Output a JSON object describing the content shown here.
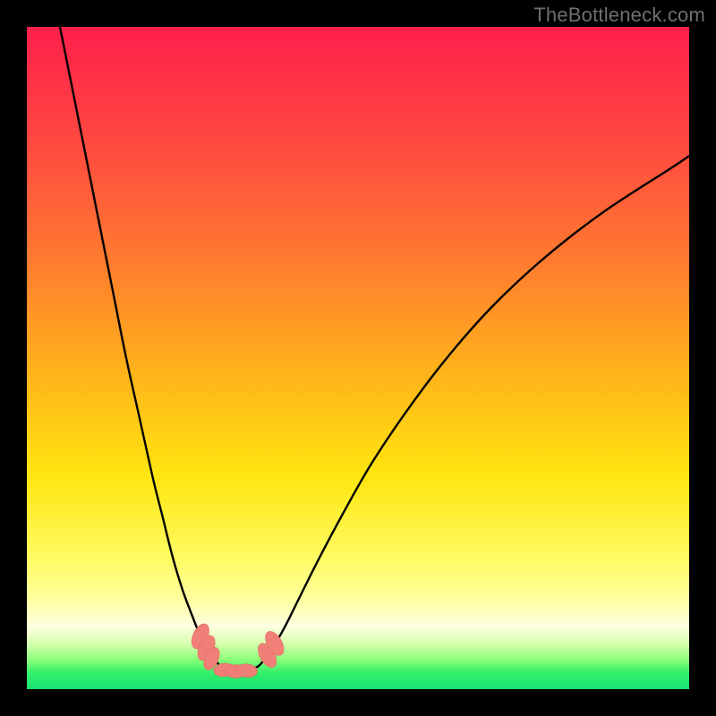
{
  "watermark": "TheBottleneck.com",
  "chart_data": {
    "type": "line",
    "title": "",
    "xlabel": "",
    "ylabel": "",
    "xlim": [
      0,
      100
    ],
    "ylim": [
      0,
      100
    ],
    "grid": false,
    "legend": false,
    "background_gradient_stops": [
      {
        "offset": 0.0,
        "color": "#ff1f4b"
      },
      {
        "offset": 0.18,
        "color": "#ff4a40"
      },
      {
        "offset": 0.35,
        "color": "#ff7a30"
      },
      {
        "offset": 0.52,
        "color": "#ffb21a"
      },
      {
        "offset": 0.68,
        "color": "#ffe610"
      },
      {
        "offset": 0.8,
        "color": "#fffb60"
      },
      {
        "offset": 0.86,
        "color": "#ffff9a"
      },
      {
        "offset": 0.905,
        "color": "#ffffe0"
      },
      {
        "offset": 0.93,
        "color": "#d9ffb0"
      },
      {
        "offset": 0.955,
        "color": "#8dff7a"
      },
      {
        "offset": 0.975,
        "color": "#34f06a"
      },
      {
        "offset": 1.0,
        "color": "#19e272"
      }
    ],
    "series": [
      {
        "name": "left-branch",
        "x": [
          5,
          7,
          9,
          11,
          13,
          15,
          17,
          19,
          20.5,
          22,
          23.5,
          25,
          26,
          27,
          27.8,
          28.4
        ],
        "y": [
          100,
          90,
          80,
          70,
          60,
          50,
          41,
          32,
          26,
          20,
          15,
          11,
          8.5,
          6.5,
          5.2,
          4.4
        ]
      },
      {
        "name": "valley",
        "x": [
          28.4,
          29.2,
          30,
          31,
          32,
          33,
          34,
          35,
          35.8
        ],
        "y": [
          4.4,
          3.5,
          3.0,
          2.7,
          2.6,
          2.7,
          3.0,
          3.5,
          4.4
        ]
      },
      {
        "name": "right-branch",
        "x": [
          35.8,
          37,
          39,
          41,
          44,
          48,
          52,
          57,
          63,
          70,
          78,
          87,
          97,
          100
        ],
        "y": [
          4.4,
          6.0,
          9.5,
          13.5,
          19.5,
          27,
          34,
          41.5,
          49.5,
          57.5,
          65,
          72,
          78.5,
          80.5
        ]
      }
    ],
    "markers": [
      {
        "name": "left-cluster",
        "points": [
          {
            "x": 26.2,
            "y": 8.0,
            "rx": 1.1,
            "ry": 2.0,
            "rot": 25
          },
          {
            "x": 27.1,
            "y": 6.2,
            "rx": 1.1,
            "ry": 2.0,
            "rot": 25
          },
          {
            "x": 27.9,
            "y": 4.6,
            "rx": 1.0,
            "ry": 1.8,
            "rot": 25
          }
        ]
      },
      {
        "name": "bottom-cluster",
        "points": [
          {
            "x": 29.8,
            "y": 2.9,
            "rx": 1.0,
            "ry": 1.6,
            "rot": 85
          },
          {
            "x": 31.5,
            "y": 2.7,
            "rx": 1.0,
            "ry": 1.6,
            "rot": 90
          },
          {
            "x": 33.2,
            "y": 2.8,
            "rx": 1.0,
            "ry": 1.6,
            "rot": 95
          }
        ]
      },
      {
        "name": "right-cluster",
        "points": [
          {
            "x": 36.3,
            "y": 5.1,
            "rx": 1.1,
            "ry": 2.0,
            "rot": -30
          },
          {
            "x": 37.4,
            "y": 6.9,
            "rx": 1.1,
            "ry": 2.0,
            "rot": -30
          }
        ]
      }
    ],
    "colors": {
      "curve": "#000000",
      "marker_fill": "#f08077",
      "marker_stroke": "#e46a62"
    }
  }
}
